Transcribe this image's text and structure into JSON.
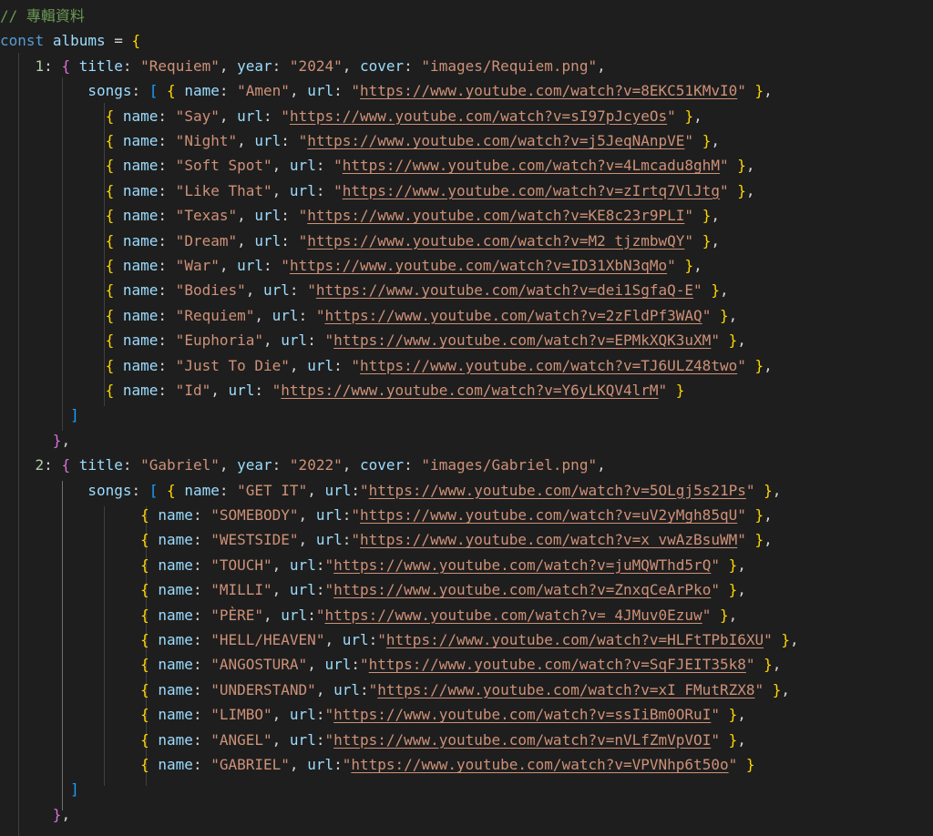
{
  "comment": "// 專輯資料",
  "declaration": {
    "keyword": "const",
    "name": "albums"
  },
  "albums": [
    {
      "key": "1",
      "title": "Requiem",
      "year": "2024",
      "cover": "images/Requiem.png",
      "songs": [
        {
          "name": "Amen",
          "url": "https://www.youtube.com/watch?v=8EKC51KMvI0"
        },
        {
          "name": "Say",
          "url": "https://www.youtube.com/watch?v=sI97pJcyeOs"
        },
        {
          "name": "Night",
          "url": "https://www.youtube.com/watch?v=j5JeqNAnpVE"
        },
        {
          "name": "Soft Spot",
          "url": "https://www.youtube.com/watch?v=4Lmcadu8ghM"
        },
        {
          "name": "Like That",
          "url": "https://www.youtube.com/watch?v=zIrtq7VlJtg"
        },
        {
          "name": "Texas",
          "url": "https://www.youtube.com/watch?v=KE8c23r9PLI"
        },
        {
          "name": "Dream",
          "url": "https://www.youtube.com/watch?v=M2_tjzmbwQY"
        },
        {
          "name": "War",
          "url": "https://www.youtube.com/watch?v=ID31XbN3qMo"
        },
        {
          "name": "Bodies",
          "url": "https://www.youtube.com/watch?v=dei1SgfaQ-E"
        },
        {
          "name": "Requiem",
          "url": "https://www.youtube.com/watch?v=2zFldPf3WAQ"
        },
        {
          "name": "Euphoria",
          "url": "https://www.youtube.com/watch?v=EPMkXQK3uXM"
        },
        {
          "name": "Just To Die",
          "url": "https://www.youtube.com/watch?v=TJ6ULZ48two"
        },
        {
          "name": "Id",
          "url": "https://www.youtube.com/watch?v=Y6yLKQV4lrM"
        }
      ]
    },
    {
      "key": "2",
      "title": "Gabriel",
      "year": "2022",
      "cover": "images/Gabriel.png",
      "songs": [
        {
          "name": "GET IT",
          "url": "https://www.youtube.com/watch?v=5OLgj5s21Ps"
        },
        {
          "name": "SOMEBODY",
          "url": "https://www.youtube.com/watch?v=uV2yMgh85qU"
        },
        {
          "name": "WESTSIDE",
          "url": "https://www.youtube.com/watch?v=x_vwAzBsuWM"
        },
        {
          "name": "TOUCH",
          "url": "https://www.youtube.com/watch?v=juMQWThd5rQ"
        },
        {
          "name": "MILLI",
          "url": "https://www.youtube.com/watch?v=ZnxqCeArPko"
        },
        {
          "name": "PÈRE",
          "url": "https://www.youtube.com/watch?v=_4JMuv0Ezuw"
        },
        {
          "name": "HELL/HEAVEN",
          "url": "https://www.youtube.com/watch?v=HLFtTPbI6XU"
        },
        {
          "name": "ANGOSTURA",
          "url": "https://www.youtube.com/watch?v=SqFJEIT35k8"
        },
        {
          "name": "UNDERSTAND",
          "url": "https://www.youtube.com/watch?v=xI_FMutRZX8"
        },
        {
          "name": "LIMBO",
          "url": "https://www.youtube.com/watch?v=ssIiBm0ORuI"
        },
        {
          "name": "ANGEL",
          "url": "https://www.youtube.com/watch?v=nVLfZmVpVOI"
        },
        {
          "name": "GABRIEL",
          "url": "https://www.youtube.com/watch?v=VPVNhp6t50o"
        }
      ]
    }
  ],
  "colors": {
    "background": "#1e1e1e",
    "comment": "#6a9955",
    "keyword": "#569cd6",
    "property": "#9cdcfe",
    "number": "#b5cea8",
    "string": "#ce9178",
    "bracket_level_1": "#ffd700",
    "bracket_level_2": "#da70d6",
    "bracket_level_3": "#179fff"
  }
}
